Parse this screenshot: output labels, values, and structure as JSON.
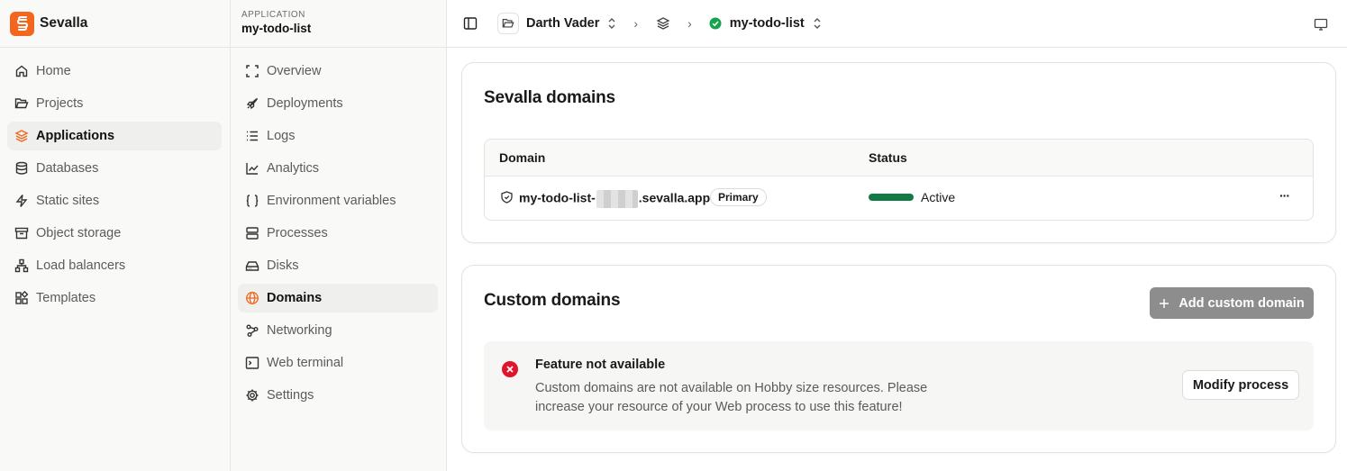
{
  "brand": {
    "name": "Sevalla"
  },
  "sidebar": {
    "items": [
      {
        "label": "Home",
        "icon": "home-icon"
      },
      {
        "label": "Projects",
        "icon": "folder-icon"
      },
      {
        "label": "Applications",
        "icon": "layers-icon",
        "active": true
      },
      {
        "label": "Databases",
        "icon": "database-icon"
      },
      {
        "label": "Static sites",
        "icon": "lightning-icon"
      },
      {
        "label": "Object storage",
        "icon": "archive-icon"
      },
      {
        "label": "Load balancers",
        "icon": "network-icon"
      },
      {
        "label": "Templates",
        "icon": "templates-icon"
      }
    ]
  },
  "application": {
    "kicker": "APPLICATION",
    "name": "my-todo-list",
    "nav": [
      {
        "label": "Overview",
        "icon": "overview-icon"
      },
      {
        "label": "Deployments",
        "icon": "rocket-icon"
      },
      {
        "label": "Logs",
        "icon": "list-icon"
      },
      {
        "label": "Analytics",
        "icon": "chart-icon"
      },
      {
        "label": "Environment variables",
        "icon": "braces-icon"
      },
      {
        "label": "Processes",
        "icon": "server-icon"
      },
      {
        "label": "Disks",
        "icon": "disk-icon"
      },
      {
        "label": "Domains",
        "icon": "globe-icon",
        "active": true
      },
      {
        "label": "Networking",
        "icon": "networking-icon"
      },
      {
        "label": "Web terminal",
        "icon": "terminal-icon"
      },
      {
        "label": "Settings",
        "icon": "gear-icon"
      }
    ]
  },
  "topbar": {
    "project": "Darth Vader",
    "app": "my-todo-list",
    "separator": "›"
  },
  "sevalla_domains": {
    "title": "Sevalla domains",
    "columns": [
      "Domain",
      "Status"
    ],
    "rows": [
      {
        "domain_prefix": "my-todo-list-",
        "domain_suffix": ".sevalla.app",
        "badge": "Primary",
        "status": "Active"
      }
    ],
    "more": "···"
  },
  "custom_domains": {
    "title": "Custom domains",
    "add_button": "Add custom domain",
    "notice_title": "Feature not available",
    "notice_text": "Custom domains are not available on Hobby size resources. Please increase your resource of your Web process to use this feature!",
    "modify_button": "Modify process"
  },
  "colors": {
    "brand": "#f2661e",
    "active_status": "#117a45",
    "status_dot": "#16a34a",
    "error": "#e0142a",
    "disabled_button": "#8d8d8d"
  }
}
